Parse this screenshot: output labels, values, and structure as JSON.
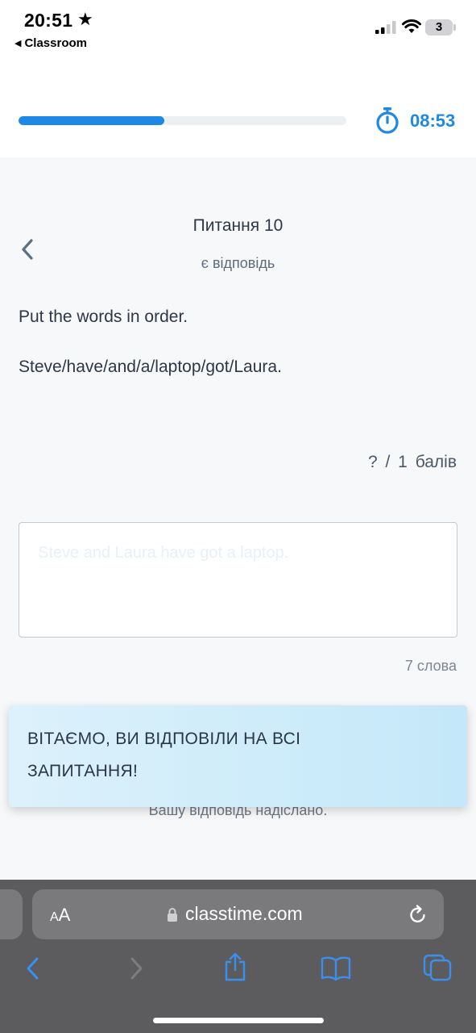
{
  "status_bar": {
    "time": "20:51",
    "back_app": "Classroom",
    "battery_level": "3"
  },
  "header": {
    "progress_fraction": 0.445,
    "timer": "08:53"
  },
  "question": {
    "title": "Питання 10",
    "status": "є відповідь",
    "instruction": "Put the words in order.",
    "text": "Steve/have/and/a/laptop/got/Laura.",
    "score": "? / 1 балів"
  },
  "answer": {
    "value": "Steve and Laura have got a laptop.",
    "word_count": "7 слова"
  },
  "toast": {
    "message": "ВІТАЄМО, ВИ ВІДПОВІЛИ НА ВСІ ЗАПИТАННЯ!"
  },
  "submitted_note": "Вашу відповідь надіслано.",
  "browser": {
    "aa_label_small": "A",
    "aa_label_large": "A",
    "url": "classtime.com"
  },
  "colors": {
    "accent": "#1e88e5",
    "toast_bg": "#c4e8f9",
    "safari_bar": "#5c5c5e"
  }
}
